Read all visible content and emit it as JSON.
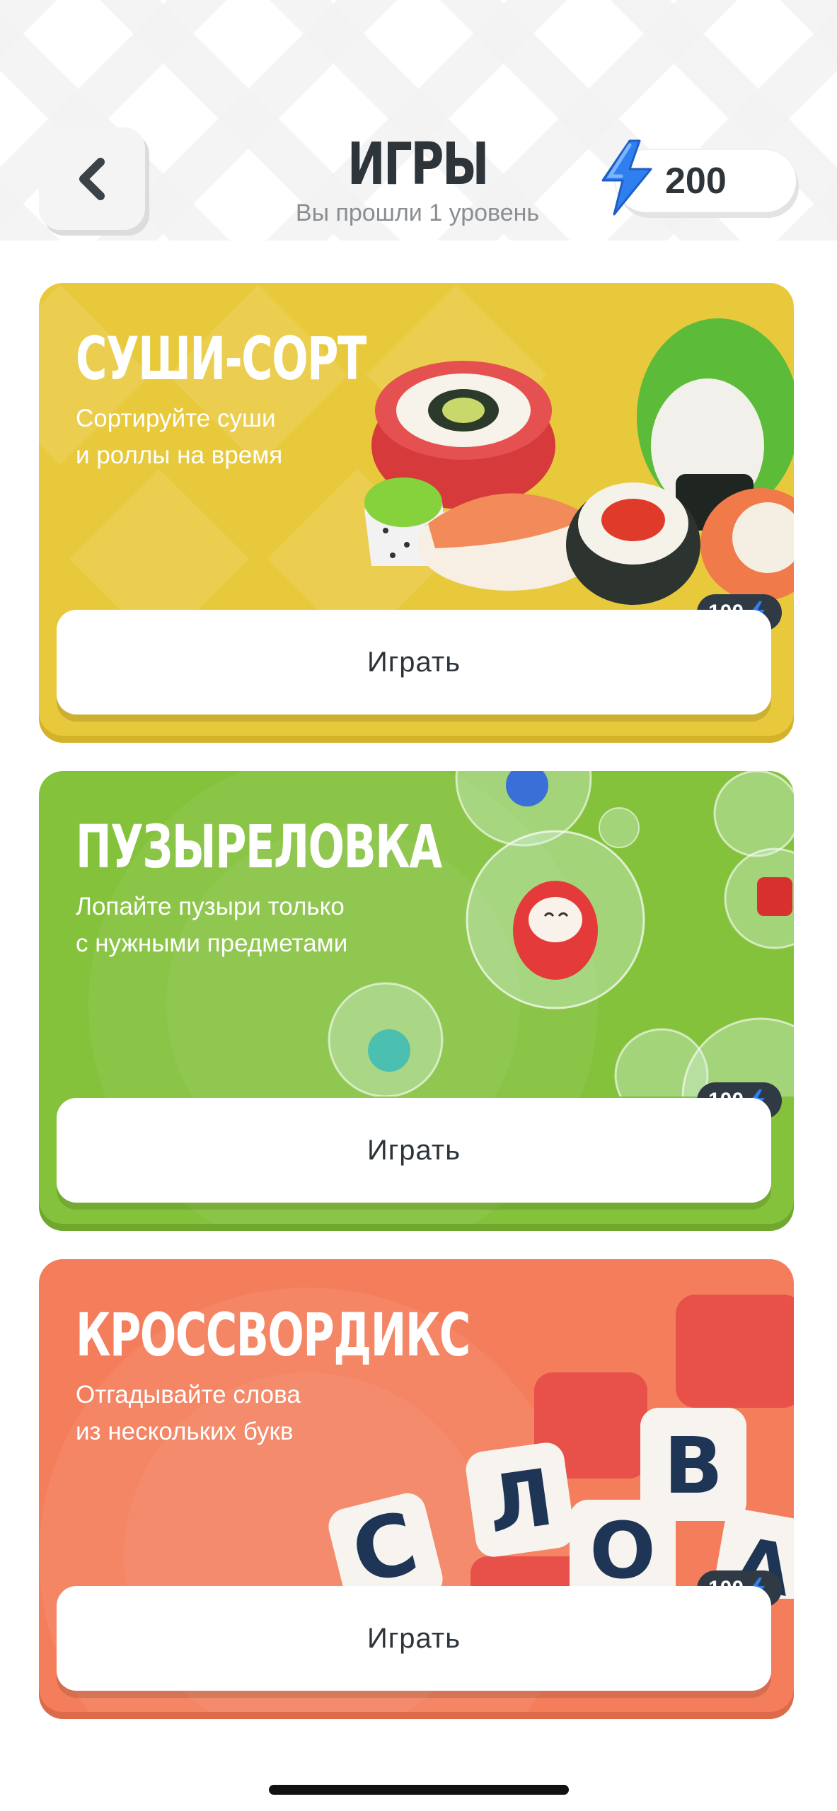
{
  "header": {
    "title": "ИГРЫ",
    "subtitle": "Вы прошли 1 уровень",
    "back_icon": "chevron-left-icon",
    "balance": "200",
    "balance_icon": "lightning-icon"
  },
  "games": [
    {
      "title": "СУШИ-СОРТ",
      "description": "Сортируйте суши\nи роллы на время",
      "play_label": "Играть",
      "price": "100",
      "color": "#e9c93c"
    },
    {
      "title": "ПУЗЫРЕЛОВКА",
      "description": "Лопайте пузыри только\nс нужными предметами",
      "play_label": "Играть",
      "price": "100",
      "color": "#84c23c"
    },
    {
      "title": "КРОССВОРДИКС",
      "description": "Отгадывайте слова\nиз нескольких букв",
      "play_label": "Играть",
      "price": "100",
      "color": "#f47e5c",
      "tiles": [
        "С",
        "Л",
        "О",
        "В",
        "А"
      ]
    }
  ],
  "colors": {
    "accent_blue": "#2f7ff0",
    "text_dark": "#2d343a",
    "badge_bg": "#2f3a44"
  }
}
